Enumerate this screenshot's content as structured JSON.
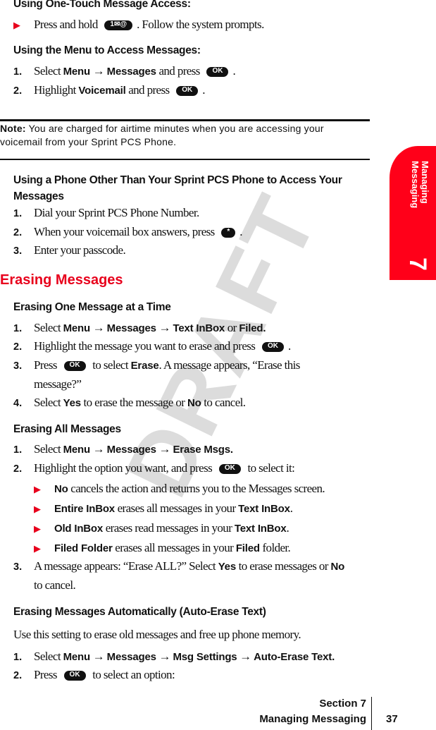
{
  "watermark": "DRAFT",
  "side_tab": {
    "label": "Managing Messaging",
    "number": "7",
    "color": "#ff0019"
  },
  "note": {
    "label": "Note:",
    "text": "You are charged for airtime minutes when you are accessing your voicemail from your Sprint PCS Phone."
  },
  "lines": [
    {
      "type": "h3",
      "segs": [
        {
          "t": "Using One-Touch Message Access:"
        }
      ]
    },
    {
      "type": "bul",
      "segs": [
        {
          "t": "Press and hold "
        },
        {
          "key": "1✉@"
        },
        {
          "t": ". Follow the system prompts."
        }
      ]
    },
    {
      "type": "h3",
      "segs": [
        {
          "t": "Using the Menu to Access Messages:"
        }
      ]
    },
    {
      "type": "step",
      "num": "1.",
      "segs": [
        {
          "t": "Select "
        },
        {
          "t": "Menu",
          "b": true
        },
        {
          "t": " → "
        },
        {
          "t": "Messages",
          "b": true
        },
        {
          "t": " and press "
        },
        {
          "key": "OK"
        },
        {
          "t": "."
        }
      ]
    },
    {
      "type": "step",
      "num": "2.",
      "segs": [
        {
          "t": "Highlight "
        },
        {
          "t": "Voicemail",
          "b": true
        },
        {
          "t": " and press "
        },
        {
          "key": "OK"
        },
        {
          "t": "."
        }
      ]
    },
    {
      "type": "h3wrap",
      "segs": [
        {
          "t": "Using a Phone Other Than Your Sprint PCS Phone to Access Your Messages"
        }
      ]
    },
    {
      "type": "step",
      "num": "1.",
      "segs": [
        {
          "t": "Dial your Sprint PCS Phone Number."
        }
      ]
    },
    {
      "type": "step",
      "num": "2.",
      "segs": [
        {
          "t": "When your voicemail box answers, press "
        },
        {
          "key": "*"
        },
        {
          "t": "."
        }
      ]
    },
    {
      "type": "step",
      "num": "3.",
      "segs": [
        {
          "t": "Enter your passcode."
        }
      ]
    },
    {
      "type": "h2",
      "segs": [
        {
          "t": "Erasing Messages"
        }
      ]
    },
    {
      "type": "h3",
      "segs": [
        {
          "t": "Erasing One Message at a Time"
        }
      ]
    },
    {
      "type": "step",
      "num": "1.",
      "segs": [
        {
          "t": "Select "
        },
        {
          "t": "Menu",
          "b": true
        },
        {
          "t": " → "
        },
        {
          "t": "Messages",
          "b": true
        },
        {
          "t": " → "
        },
        {
          "t": "Text InBox",
          "b": true
        },
        {
          "t": " or "
        },
        {
          "t": "Filed.",
          "b": true
        }
      ]
    },
    {
      "type": "step",
      "num": "2.",
      "segs": [
        {
          "t": "Highlight the message you want to erase and press "
        },
        {
          "key": "OK"
        },
        {
          "t": "."
        }
      ]
    },
    {
      "type": "step",
      "num": "3.",
      "segs": [
        {
          "t": "Press "
        },
        {
          "key": "OK"
        },
        {
          "t": " to select "
        },
        {
          "t": "Erase",
          "b": true
        },
        {
          "t": ". A message appears, “Erase this"
        }
      ]
    },
    {
      "type": "cont",
      "segs": [
        {
          "t": "message?”"
        }
      ]
    },
    {
      "type": "step",
      "num": "4.",
      "segs": [
        {
          "t": "Select "
        },
        {
          "t": "Yes",
          "b": true
        },
        {
          "t": " to erase the message or "
        },
        {
          "t": "No",
          "b": true
        },
        {
          "t": " to cancel."
        }
      ]
    },
    {
      "type": "h3",
      "segs": [
        {
          "t": "Erasing All Messages"
        }
      ]
    },
    {
      "type": "step",
      "num": "1.",
      "segs": [
        {
          "t": "Select "
        },
        {
          "t": "Menu",
          "b": true
        },
        {
          "t": " → "
        },
        {
          "t": "Messages",
          "b": true
        },
        {
          "t": " → "
        },
        {
          "t": "Erase Msgs.",
          "b": true
        }
      ]
    },
    {
      "type": "step",
      "num": "2.",
      "segs": [
        {
          "t": "Highlight the option you want, and press "
        },
        {
          "key": "OK"
        },
        {
          "t": " to select it:"
        }
      ]
    },
    {
      "type": "sub",
      "segs": [
        {
          "t": "No",
          "b": true
        },
        {
          "t": " cancels the action and returns you to the Messages screen."
        }
      ]
    },
    {
      "type": "sub",
      "segs": [
        {
          "t": "Entire InBox",
          "b": true
        },
        {
          "t": " erases all messages in your "
        },
        {
          "t": "Text InBox",
          "b": true
        },
        {
          "t": "."
        }
      ]
    },
    {
      "type": "sub",
      "segs": [
        {
          "t": "Old InBox",
          "b": true
        },
        {
          "t": " erases read messages in your "
        },
        {
          "t": "Text InBox",
          "b": true
        },
        {
          "t": "."
        }
      ]
    },
    {
      "type": "sub",
      "segs": [
        {
          "t": "Filed Folder",
          "b": true
        },
        {
          "t": " erases all messages in your "
        },
        {
          "t": "Filed",
          "b": true
        },
        {
          "t": " folder."
        }
      ]
    },
    {
      "type": "step",
      "num": "3.",
      "segs": [
        {
          "t": "A message appears: “Erase ALL?” Select "
        },
        {
          "t": "Yes",
          "b": true
        },
        {
          "t": " to erase messages or "
        },
        {
          "t": "No",
          "b": true
        }
      ]
    },
    {
      "type": "cont",
      "segs": [
        {
          "t": "to cancel."
        }
      ]
    },
    {
      "type": "h3",
      "segs": [
        {
          "t": "Erasing Messages Automatically (Auto-Erase Text)"
        }
      ]
    },
    {
      "type": "para",
      "segs": [
        {
          "t": "Use this setting to erase old messages and free up phone memory."
        }
      ]
    },
    {
      "type": "step",
      "num": "1.",
      "segs": [
        {
          "t": "Select "
        },
        {
          "t": "Menu",
          "b": true
        },
        {
          "t": " → "
        },
        {
          "t": "Messages",
          "b": true
        },
        {
          "t": " → "
        },
        {
          "t": "Msg Settings",
          "b": true
        },
        {
          "t": " → "
        },
        {
          "t": "Auto-Erase Text.",
          "b": true
        }
      ]
    },
    {
      "type": "step",
      "num": "2.",
      "segs": [
        {
          "t": "Press "
        },
        {
          "key": "OK"
        },
        {
          "t": " to select an option:"
        }
      ]
    }
  ],
  "footer": {
    "section": "Section 7",
    "chapter": "Managing Messaging",
    "page": "37"
  }
}
